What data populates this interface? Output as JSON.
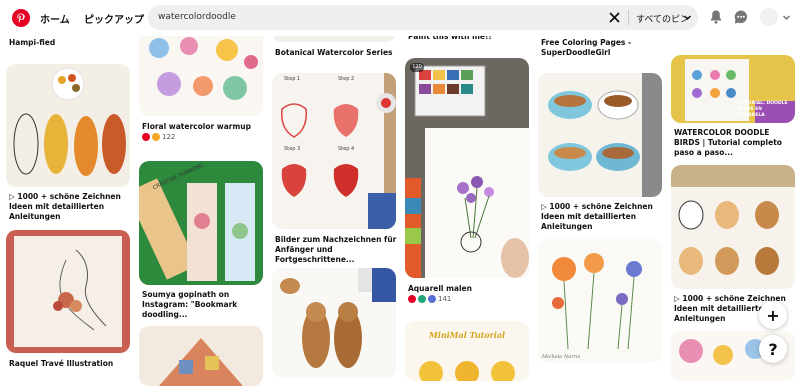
{
  "header": {
    "home_label": "ホーム",
    "pickup_label": "ピックアップ",
    "search_value": "watercolordoodle",
    "scope_label": "すべてのピン"
  },
  "colors": {
    "brand": "#e60023",
    "search_bg": "#efefef"
  },
  "icons": [
    "pinterest-logo-icon",
    "close-icon",
    "chevron-down-icon",
    "bell-icon",
    "chat-icon",
    "plus-icon",
    "help-icon"
  ],
  "pins": {
    "c1_top_title": "Hampi-fied",
    "c1_a_title": "▷ 1000 + schöne Zeichnen Ideen mit detaillierten Anleitungen",
    "c1_b_title": "Raquel Travé Illustration",
    "c2_a_title": "Floral watercolor warmup",
    "c2_a_count": "122",
    "c2_b_title": "Soumya gopinath on Instagram: \"Bookmark doodling...",
    "c2_b_bookmark_text": "CREATIVE THINKING",
    "c3_top_title": "Botanical Watercolor Series",
    "c3_a_title": "Bilder zum Nachzeichnen für Anfänger und Fortgeschrittene...",
    "c3_a_steps": [
      "Step 1",
      "Step 2",
      "Step 3",
      "Step 4"
    ],
    "c4_top_title": "Paint this with me!!",
    "c4_a_title": "Aquarell malen",
    "c4_a_count": "141",
    "c4_a_badge": "120",
    "c4_b_banner": "MiniMal Tutorial",
    "c5_top_title": "Free Coloring Pages - SuperDoodleGirl",
    "c5_a_title": "▷ 1000 + schöne Zeichnen Ideen mit detaillierten Anleitungen",
    "c5_b_caption": "Michele Norris",
    "c6_a_title": "WATERCOLOR DOODLE BIRDS | Tutorial completo paso a paso...",
    "c6_a_badge": "TUTORIAL: DOODLE BIRDS EN ACUARELA",
    "c6_b_title": "▷ 1000 + schöne Zeichnen Ideen mit detaillierten Anleitungen"
  },
  "fab": {
    "add": "+",
    "help": "?"
  }
}
